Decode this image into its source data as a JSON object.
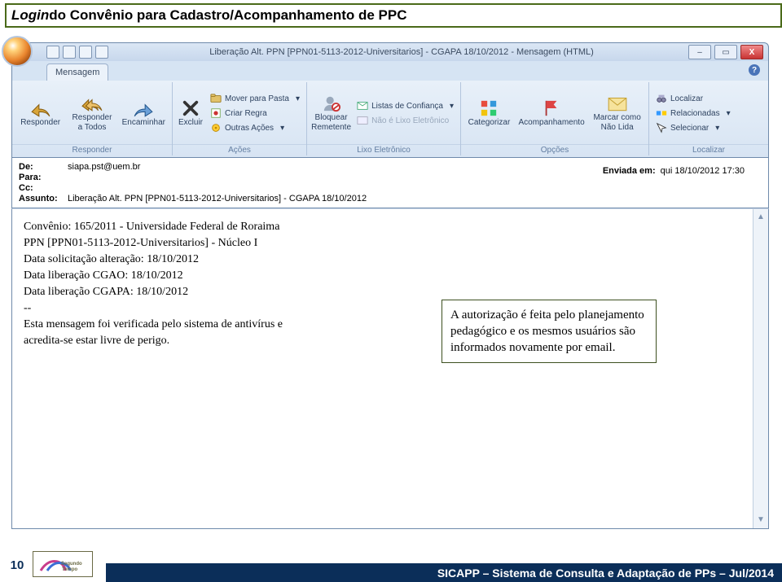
{
  "page_title_prefix": "Login",
  "page_title_rest": " do Convênio para Cadastro/Acompanhamento de PPC",
  "window_title": "Liberação Alt. PPN [PPN01-5113-2012-Universitarios] - CGAPA 18/10/2012 - Mensagem (HTML)",
  "tab_label": "Mensagem",
  "ribbon": {
    "groups": {
      "responder": {
        "label": "Responder",
        "buttons": {
          "responder": "Responder",
          "responder_todos_l1": "Responder",
          "responder_todos_l2": "a Todos",
          "encaminhar": "Encaminhar"
        }
      },
      "acoes": {
        "label": "Ações",
        "excluir": "Excluir",
        "mover": "Mover para Pasta",
        "regra": "Criar Regra",
        "outras": "Outras Ações"
      },
      "lixo": {
        "label": "Lixo Eletrônico",
        "bloquear_l1": "Bloquear",
        "bloquear_l2": "Remetente",
        "listas": "Listas de Confiança",
        "naolixo": "Não é Lixo Eletrônico"
      },
      "opcoes": {
        "label": "Opções",
        "categorizar": "Categorizar",
        "acomp": "Acompanhamento",
        "marcar_l1": "Marcar como",
        "marcar_l2": "Não Lida"
      },
      "localizar": {
        "label": "Localizar",
        "localizar": "Localizar",
        "relacionadas": "Relacionadas",
        "selecionar": "Selecionar"
      }
    }
  },
  "header": {
    "de_label": "De:",
    "de_value": "siapa.pst@uem.br",
    "para_label": "Para:",
    "para_value": "",
    "cc_label": "Cc:",
    "cc_value": "",
    "assunto_label": "Assunto:",
    "assunto_value": "Liberação Alt. PPN [PPN01-5113-2012-Universitarios] - CGAPA 18/10/2012",
    "enviada_label": "Enviada em:",
    "enviada_value": "qui 18/10/2012 17:30"
  },
  "body_lines": {
    "l0": "",
    "l1": "Convênio: 165/2011 - Universidade Federal de Roraima",
    "l2": "PPN [PPN01-5113-2012-Universitarios] - Núcleo I",
    "l3": "Data solicitação alteração: 18/10/2012",
    "l4": "Data liberação CGAO: 18/10/2012",
    "l5": "Data liberação CGAPA: 18/10/2012",
    "l6": "--",
    "l7": "Esta mensagem foi verificada pelo sistema de antivírus e",
    "l8": "acredita-se estar livre de perigo."
  },
  "callout": "A autorização é feita pelo planejamento pedagógico e os mesmos usuários são informados novamente por email.",
  "footer": {
    "page_number": "10",
    "text": "SICAPP – Sistema de Consulta e Adaptação de PPs – Jul/2014"
  }
}
